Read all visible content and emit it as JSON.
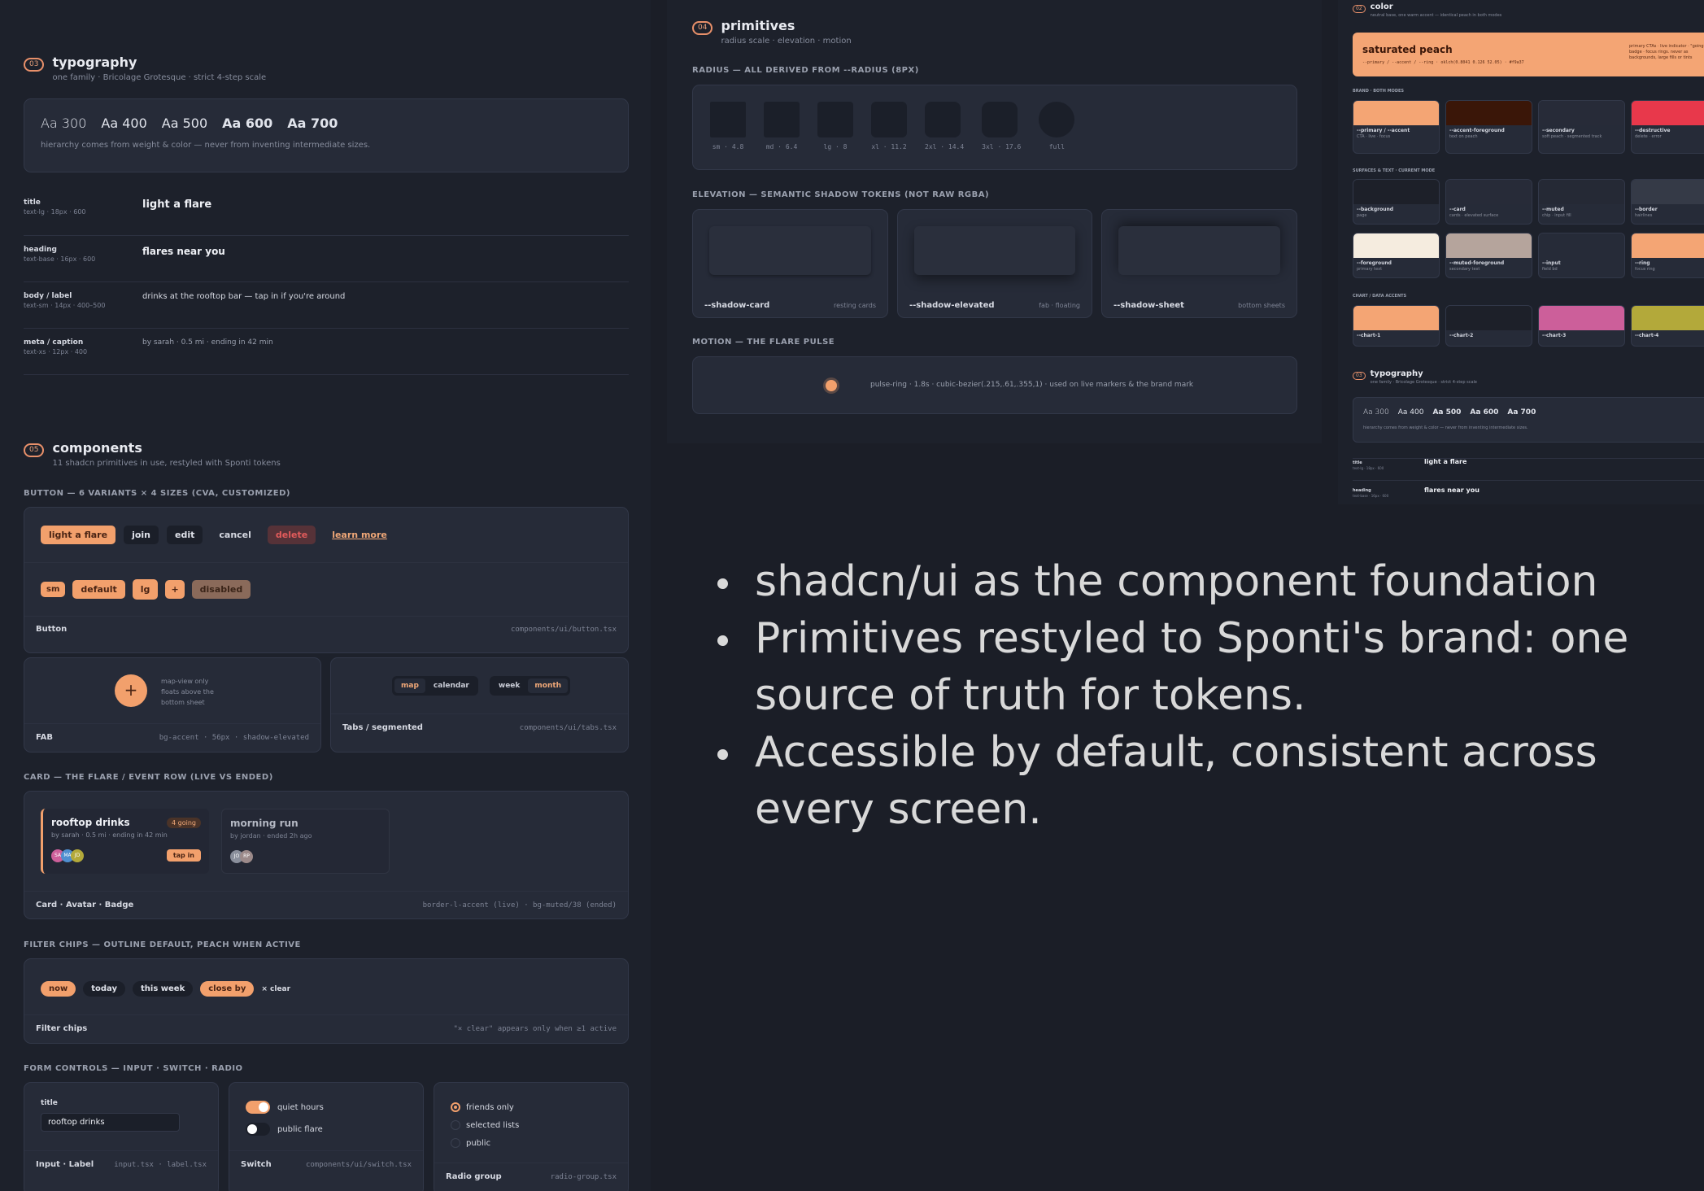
{
  "typography": {
    "num": "03",
    "title": "typography",
    "subtitle": "one family · Bricolage Grotesque · strict 4-step scale",
    "weights": [
      "Aa 300",
      "Aa 400",
      "Aa 500",
      "Aa 600",
      "Aa 700"
    ],
    "hint": "hierarchy comes from weight & color — never from inventing intermediate sizes.",
    "rows": [
      {
        "name": "title",
        "spec": "text-lg · 18px · 600",
        "sample": "light a flare"
      },
      {
        "name": "heading",
        "spec": "text-base · 16px · 600",
        "sample": "flares near you"
      },
      {
        "name": "body / label",
        "spec": "text-sm · 14px · 400–500",
        "sample": "drinks at the rooftop bar — tap in if you're around"
      },
      {
        "name": "meta / caption",
        "spec": "text-xs · 12px · 400",
        "sample": "by sarah · 0.5 mi · ending in 42 min"
      }
    ]
  },
  "components": {
    "num": "05",
    "title": "components",
    "subtitle": "11 shadcn primitives in use, restyled with Sponti tokens",
    "button_caption": "BUTTON — 6 VARIANTS × 4 SIZES (CVA, CUSTOMIZED)",
    "variants": [
      "light a flare",
      "join",
      "edit",
      "cancel",
      "delete",
      "learn more"
    ],
    "sizes": [
      "sm",
      "default",
      "lg",
      "+",
      "disabled"
    ],
    "button_label": "Button",
    "button_file": "components/ui/button.tsx",
    "fab_note": "map-view only floats above the bottom sheet",
    "fab_icon": "+",
    "fab_label": "FAB",
    "fab_spec": "bg-accent · 56px · shadow-elevated",
    "tabs_a": [
      "map",
      "calendar"
    ],
    "tabs_b": [
      "week",
      "month"
    ],
    "tabs_label": "Tabs / segmented",
    "tabs_file": "components/ui/tabs.tsx",
    "card_caption": "CARD — THE FLARE / EVENT ROW (LIVE VS ENDED)",
    "live_title": "rooftop drinks",
    "live_badge": "4 going",
    "live_meta": "by sarah · 0.5 mi · ending in 42 min",
    "live_avatars": [
      "SA",
      "MA",
      "JD"
    ],
    "live_action": "tap in",
    "ended_title": "morning run",
    "ended_meta": "by jordan · ended 2h ago",
    "ended_avatars": [
      "JO",
      "RP"
    ],
    "card_label": "Card · Avatar · Badge",
    "card_spec": "border-l-accent (live) · bg-muted/38 (ended)",
    "chips_caption": "FILTER CHIPS — OUTLINE DEFAULT, PEACH WHEN ACTIVE",
    "chips": [
      "now",
      "today",
      "this week",
      "close by"
    ],
    "chips_clear": "× clear",
    "chips_label": "Filter chips",
    "chips_note": "\"× clear\" appears only when ≥1 active",
    "form_caption": "FORM CONTROLS — INPUT · SWITCH · RADIO",
    "input_label": "title",
    "input_value": "rooftop drinks",
    "input_footer": "Input · Label",
    "input_file": "input.tsx · label.tsx",
    "switch_on": "quiet hours",
    "switch_off": "public flare",
    "switch_footer": "Switch",
    "switch_file": "components/ui/switch.tsx",
    "radios": [
      "friends only",
      "selected lists",
      "public"
    ],
    "radio_footer": "Radio group",
    "radio_file": "radio-group.tsx"
  },
  "primitives": {
    "num": "04",
    "title": "primitives",
    "subtitle": "radius scale · elevation · motion",
    "radius_caption": "RADIUS — ALL DERIVED FROM --RADIUS (8PX)",
    "radii": [
      "sm · 4.8",
      "md · 6.4",
      "lg · 8",
      "xl · 11.2",
      "2xl · 14.4",
      "3xl · 17.6",
      "full"
    ],
    "elev_caption": "ELEVATION — SEMANTIC SHADOW TOKENS (NOT RAW RGBA)",
    "shadows": [
      {
        "name": "--shadow-card",
        "use": "resting cards"
      },
      {
        "name": "--shadow-elevated",
        "use": "fab · floating"
      },
      {
        "name": "--shadow-sheet",
        "use": "bottom sheets"
      }
    ],
    "motion_caption": "MOTION — THE FLARE PULSE",
    "motion_text": "pulse-ring · 1.8s · cubic-bezier(.215,.61,.355,1) · used on live markers & the brand mark"
  },
  "color": {
    "num": "02",
    "title": "color",
    "subtitle": "neutral base, one warm accent — identical peach in both modes",
    "hero_title": "saturated peach",
    "hero_vars": "--primary / --accent / --ring · oklch(0.8041 0.126 52.05) · #f9a37",
    "hero_note": "primary CTAs · live indicator · \"going\" badge · focus rings. never as backgrounds, large fills or tints",
    "brand_caption": "BRAND · BOTH MODES",
    "brand": [
      {
        "name": "--primary / --accent",
        "use": "CTA · live · focus",
        "color": "#f4a574"
      },
      {
        "name": "--accent-foreground",
        "use": "text on peach",
        "color": "#3a1608"
      },
      {
        "name": "--secondary",
        "use": "soft peach · segmented track",
        "color": "#272b38"
      },
      {
        "name": "--destructive",
        "use": "delete · error",
        "color": "#e8384b"
      }
    ],
    "surfaces_caption": "SURFACES & TEXT · CURRENT MODE",
    "surfaces": [
      {
        "name": "--background",
        "use": "page",
        "color": "#1d2029"
      },
      {
        "name": "--card",
        "use": "cards · elevated surface",
        "color": "#272b38"
      },
      {
        "name": "--muted",
        "use": "chip · input fill",
        "color": "#252935"
      },
      {
        "name": "--border",
        "use": "hairlines",
        "color": "#353a47"
      },
      {
        "name": "--foreground",
        "use": "primary text",
        "color": "#f5ecdf"
      },
      {
        "name": "--muted-foreground",
        "use": "secondary text",
        "color": "#b5a49c"
      },
      {
        "name": "--input",
        "use": "field bd",
        "color": "#262b38"
      },
      {
        "name": "--ring",
        "use": "focus ring",
        "color": "#f4a574"
      }
    ],
    "chart_caption": "CHART / DATA ACCENTS",
    "charts": [
      {
        "name": "--chart-1",
        "color": "#f4a574"
      },
      {
        "name": "--chart-2",
        "color": "#1d2029"
      },
      {
        "name": "--chart-3",
        "color": "#cc5f9a"
      },
      {
        "name": "--chart-4",
        "color": "#b3a93a"
      }
    ],
    "mini_num": "03",
    "mini_title": "typography",
    "mini_sub": "one family · Bricolage Grotesque · strict 4-step scale",
    "mini_weights": [
      "Aa 300",
      "Aa 400",
      "Aa 500",
      "Aa 600",
      "Aa 700"
    ],
    "mini_hint": "hierarchy comes from weight & color — never from inventing intermediate sizes.",
    "mini_rows": [
      {
        "name": "title",
        "spec": "text-lg · 18px · 600",
        "sample": "light a flare"
      },
      {
        "name": "heading",
        "spec": "text-base · 16px · 600",
        "sample": "flares near you"
      }
    ]
  },
  "bullets": [
    "shadcn/ui as the component foundation",
    "Primitives restyled to Sponti's brand: one source of truth for tokens.",
    "Accessible by default, consistent across every screen."
  ]
}
